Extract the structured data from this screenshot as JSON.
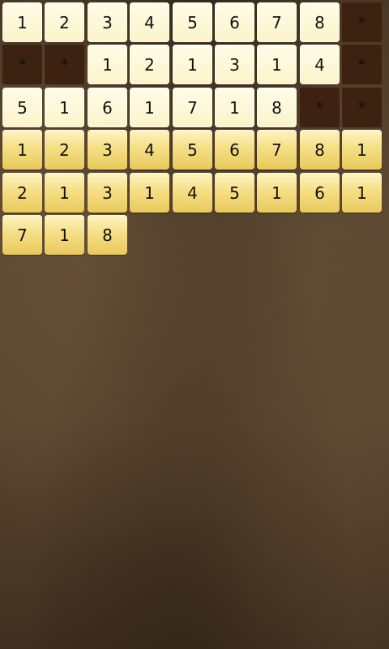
{
  "colors": {
    "cream_tile": "#fdf8d8",
    "gold_tile": "#f5df86",
    "struck_tile": "#3d2211",
    "background": "#5a4630"
  },
  "rows": [
    [
      {
        "value": "1",
        "state": "cream"
      },
      {
        "value": "2",
        "state": "cream"
      },
      {
        "value": "3",
        "state": "cream"
      },
      {
        "value": "4",
        "state": "cream"
      },
      {
        "value": "5",
        "state": "cream"
      },
      {
        "value": "6",
        "state": "cream"
      },
      {
        "value": "7",
        "state": "cream"
      },
      {
        "value": "8",
        "state": "cream"
      },
      {
        "value": "*",
        "state": "dark"
      }
    ],
    [
      {
        "value": "*",
        "state": "dark"
      },
      {
        "value": "*",
        "state": "dark"
      },
      {
        "value": "1",
        "state": "cream"
      },
      {
        "value": "2",
        "state": "cream"
      },
      {
        "value": "1",
        "state": "cream"
      },
      {
        "value": "3",
        "state": "cream"
      },
      {
        "value": "1",
        "state": "cream"
      },
      {
        "value": "4",
        "state": "cream"
      },
      {
        "value": "*",
        "state": "dark"
      }
    ],
    [
      {
        "value": "5",
        "state": "cream"
      },
      {
        "value": "1",
        "state": "cream"
      },
      {
        "value": "6",
        "state": "cream"
      },
      {
        "value": "1",
        "state": "cream"
      },
      {
        "value": "7",
        "state": "cream"
      },
      {
        "value": "1",
        "state": "cream"
      },
      {
        "value": "8",
        "state": "cream"
      },
      {
        "value": "*",
        "state": "dark"
      },
      {
        "value": "*",
        "state": "dark"
      }
    ],
    [
      {
        "value": "1",
        "state": "gold"
      },
      {
        "value": "2",
        "state": "gold"
      },
      {
        "value": "3",
        "state": "gold"
      },
      {
        "value": "4",
        "state": "gold"
      },
      {
        "value": "5",
        "state": "gold"
      },
      {
        "value": "6",
        "state": "gold"
      },
      {
        "value": "7",
        "state": "gold"
      },
      {
        "value": "8",
        "state": "gold"
      },
      {
        "value": "1",
        "state": "gold"
      }
    ],
    [
      {
        "value": "2",
        "state": "gold"
      },
      {
        "value": "1",
        "state": "gold"
      },
      {
        "value": "3",
        "state": "gold"
      },
      {
        "value": "1",
        "state": "gold"
      },
      {
        "value": "4",
        "state": "gold"
      },
      {
        "value": "5",
        "state": "gold"
      },
      {
        "value": "1",
        "state": "gold"
      },
      {
        "value": "6",
        "state": "gold"
      },
      {
        "value": "1",
        "state": "gold"
      }
    ],
    [
      {
        "value": "7",
        "state": "gold"
      },
      {
        "value": "1",
        "state": "gold"
      },
      {
        "value": "8",
        "state": "gold"
      }
    ]
  ]
}
